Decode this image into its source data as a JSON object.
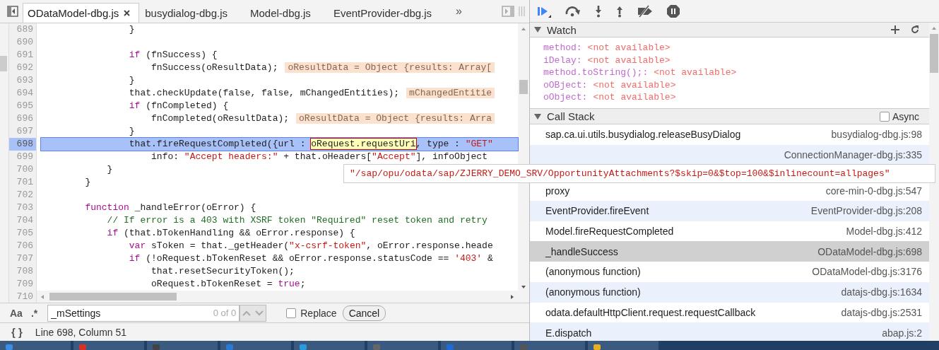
{
  "editor_tabs": [
    {
      "label": "ODataModel-dbg.js",
      "selected": true
    },
    {
      "label": "busydialog-dbg.js",
      "selected": false
    },
    {
      "label": "Model-dbg.js",
      "selected": false
    },
    {
      "label": "EventProvider-dbg.js",
      "selected": false
    }
  ],
  "more_tabs": "»",
  "code": {
    "lines": [
      {
        "n": "689",
        "current": false,
        "segs": [
          {
            "kind": "plain",
            "t": "                }"
          }
        ]
      },
      {
        "n": "690",
        "current": false
      },
      {
        "n": "691",
        "current": false,
        "segs": [
          {
            "kind": "kw",
            "t": "                if"
          },
          {
            "kind": "plain",
            "t": " (fnSuccess) {"
          }
        ]
      },
      {
        "n": "692",
        "current": false,
        "segs": [
          {
            "kind": "plain",
            "t": "                    fnSuccess(oResultData);"
          }
        ],
        "inline_value": "oResultData = Object {results: Array["
      },
      {
        "n": "693",
        "current": false,
        "segs": [
          {
            "kind": "plain",
            "t": "                }"
          }
        ]
      },
      {
        "n": "694",
        "current": false,
        "segs": [
          {
            "kind": "plain",
            "t": "                that.checkUpdate(false, false, mChangedEntities);"
          }
        ],
        "inline_value": "mChangedEntitie"
      },
      {
        "n": "695",
        "current": false,
        "segs": [
          {
            "kind": "kw",
            "t": "                if"
          },
          {
            "kind": "plain",
            "t": " (fnCompleted) {"
          }
        ]
      },
      {
        "n": "696",
        "current": false,
        "segs": [
          {
            "kind": "plain",
            "t": "                    fnCompleted(oResultData);"
          }
        ],
        "inline_value": "oResultData = Object {results: Arra"
      },
      {
        "n": "697",
        "current": false,
        "segs": [
          {
            "kind": "plain",
            "t": "                }"
          }
        ]
      },
      {
        "n": "698",
        "current": true,
        "segs": [
          {
            "kind": "plain",
            "t": "                that.fireRequestCompleted({url : "
          },
          {
            "kind": "hover",
            "t": "oRequest.requestUri"
          },
          {
            "kind": "plain",
            "t": ", type : "
          },
          {
            "kind": "str",
            "t": "\"GET\""
          }
        ]
      },
      {
        "n": "699",
        "current": false,
        "segs": [
          {
            "kind": "plain",
            "t": "                    info: "
          },
          {
            "kind": "str",
            "t": "\"Accept headers:\""
          },
          {
            "kind": "plain",
            "t": " + that.oHeaders["
          },
          {
            "kind": "str",
            "t": "\"Accept\""
          },
          {
            "kind": "plain",
            "t": "], infoObject"
          }
        ]
      },
      {
        "n": "700",
        "current": false,
        "segs": [
          {
            "kind": "plain",
            "t": "            }"
          }
        ]
      },
      {
        "n": "701",
        "current": false,
        "segs": [
          {
            "kind": "plain",
            "t": "        }"
          }
        ]
      },
      {
        "n": "702",
        "current": false
      },
      {
        "n": "703",
        "current": false,
        "segs": [
          {
            "kind": "kw",
            "t": "        function"
          },
          {
            "kind": "plain",
            "t": " _handleError(oError) {"
          }
        ]
      },
      {
        "n": "704",
        "current": false,
        "segs": [
          {
            "kind": "cm",
            "t": "            // If error is a 403 with XSRF token \"Required\" reset token and retry"
          }
        ]
      },
      {
        "n": "705",
        "current": false,
        "segs": [
          {
            "kind": "kw",
            "t": "            if"
          },
          {
            "kind": "plain",
            "t": " (that.bTokenHandling && oError.response) {"
          }
        ]
      },
      {
        "n": "706",
        "current": false,
        "segs": [
          {
            "kind": "kw",
            "t": "                var"
          },
          {
            "kind": "plain",
            "t": " sToken = that._getHeader("
          },
          {
            "kind": "str",
            "t": "\"x-csrf-token\""
          },
          {
            "kind": "plain",
            "t": ", oError.response.heade"
          }
        ]
      },
      {
        "n": "707",
        "current": false,
        "segs": [
          {
            "kind": "kw",
            "t": "                if"
          },
          {
            "kind": "plain",
            "t": " (!oRequest.bTokenReset && oError.response.statusCode == "
          },
          {
            "kind": "str",
            "t": "'403'"
          },
          {
            "kind": "plain",
            "t": " &"
          }
        ]
      },
      {
        "n": "708",
        "current": false,
        "segs": [
          {
            "kind": "plain",
            "t": "                    that.resetSecurityToken();"
          }
        ]
      },
      {
        "n": "709",
        "current": false,
        "segs": [
          {
            "kind": "plain",
            "t": "                    oRequest.bTokenReset = "
          },
          {
            "kind": "kw",
            "t": "true"
          },
          {
            "kind": "plain",
            "t": ";"
          }
        ]
      },
      {
        "n": "710",
        "current": false
      }
    ]
  },
  "tooltip": "\"/sap/opu/odata/sap/ZJERRY_DEMO_SRV/OpportunityAttachments?$skip=0&$top=100&$inlinecount=allpages\"",
  "search_bar": {
    "case_toggle": "Aa",
    "regex_toggle": ".*",
    "value": "_mSettings",
    "count": "0 of 0",
    "replace": {
      "label": "Replace",
      "checked": false
    },
    "cancel": "Cancel"
  },
  "status_bar": {
    "pretty_print": "{ }",
    "position": "Line 698, Column 51"
  },
  "watch": {
    "title": "Watch",
    "expanded": true,
    "items": [
      {
        "name": "method:",
        "value": "<not available>"
      },
      {
        "name": "iDelay:",
        "value": "<not available>"
      },
      {
        "name": "method.toString();:",
        "value": "<not available>"
      },
      {
        "name": "oOBject:",
        "value": "<not available>"
      },
      {
        "name": "oObject:",
        "value": "<not available>"
      }
    ]
  },
  "call_stack": {
    "title": "Call Stack",
    "expanded": true,
    "async": {
      "label": "Async",
      "checked": false
    },
    "frames": [
      {
        "function": "sap.ca.ui.utils.busydialog.releaseBusyDialog",
        "location": "busydialog-dbg.js:98",
        "selected": false
      },
      {
        "location": "ConnectionManager-dbg.js:335",
        "selected": false
      },
      {
        "function": "proxy",
        "location": "core-min-0-dbg.js:547",
        "selected": false
      },
      {
        "function": "EventProvider.fireEvent",
        "location": "EventProvider-dbg.js:208",
        "selected": false
      },
      {
        "function": "Model.fireRequestCompleted",
        "location": "Model-dbg.js:412",
        "selected": false
      },
      {
        "function": "_handleSuccess",
        "location": "ODataModel-dbg.js:698",
        "selected": true
      },
      {
        "function": "(anonymous function)",
        "location": "ODataModel-dbg.js:3176",
        "selected": false
      },
      {
        "function": "(anonymous function)",
        "location": "datajs-dbg.js:1634",
        "selected": false
      },
      {
        "function": "odata.defaultHttpClient.request.requestCallback",
        "location": "datajs-dbg.js:2531",
        "selected": false
      },
      {
        "function": "E.dispatch",
        "location": "abap.js:2",
        "selected": false
      }
    ]
  }
}
